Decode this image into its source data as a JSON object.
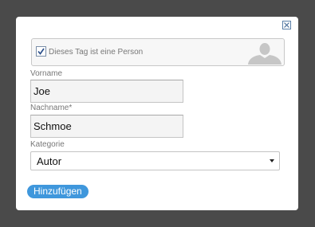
{
  "dialog": {
    "close_icon": "close-x-icon",
    "person_toggle": {
      "checked": true,
      "label": "Dieses Tag ist eine Person",
      "avatar_icon": "person-silhouette-icon"
    },
    "first_name": {
      "label": "Vorname",
      "value": "Joe"
    },
    "last_name": {
      "label": "Nachname*",
      "value": "Schmoe"
    },
    "category": {
      "label": "Kategorie",
      "selected": "Autor"
    },
    "submit_label": "Hinzufügen"
  },
  "colors": {
    "backdrop": "#4a4a4a",
    "dialog_bg": "#ffffff",
    "accent": "#3f97dc",
    "label_text": "#777777",
    "input_bg": "#f4f4f4"
  }
}
